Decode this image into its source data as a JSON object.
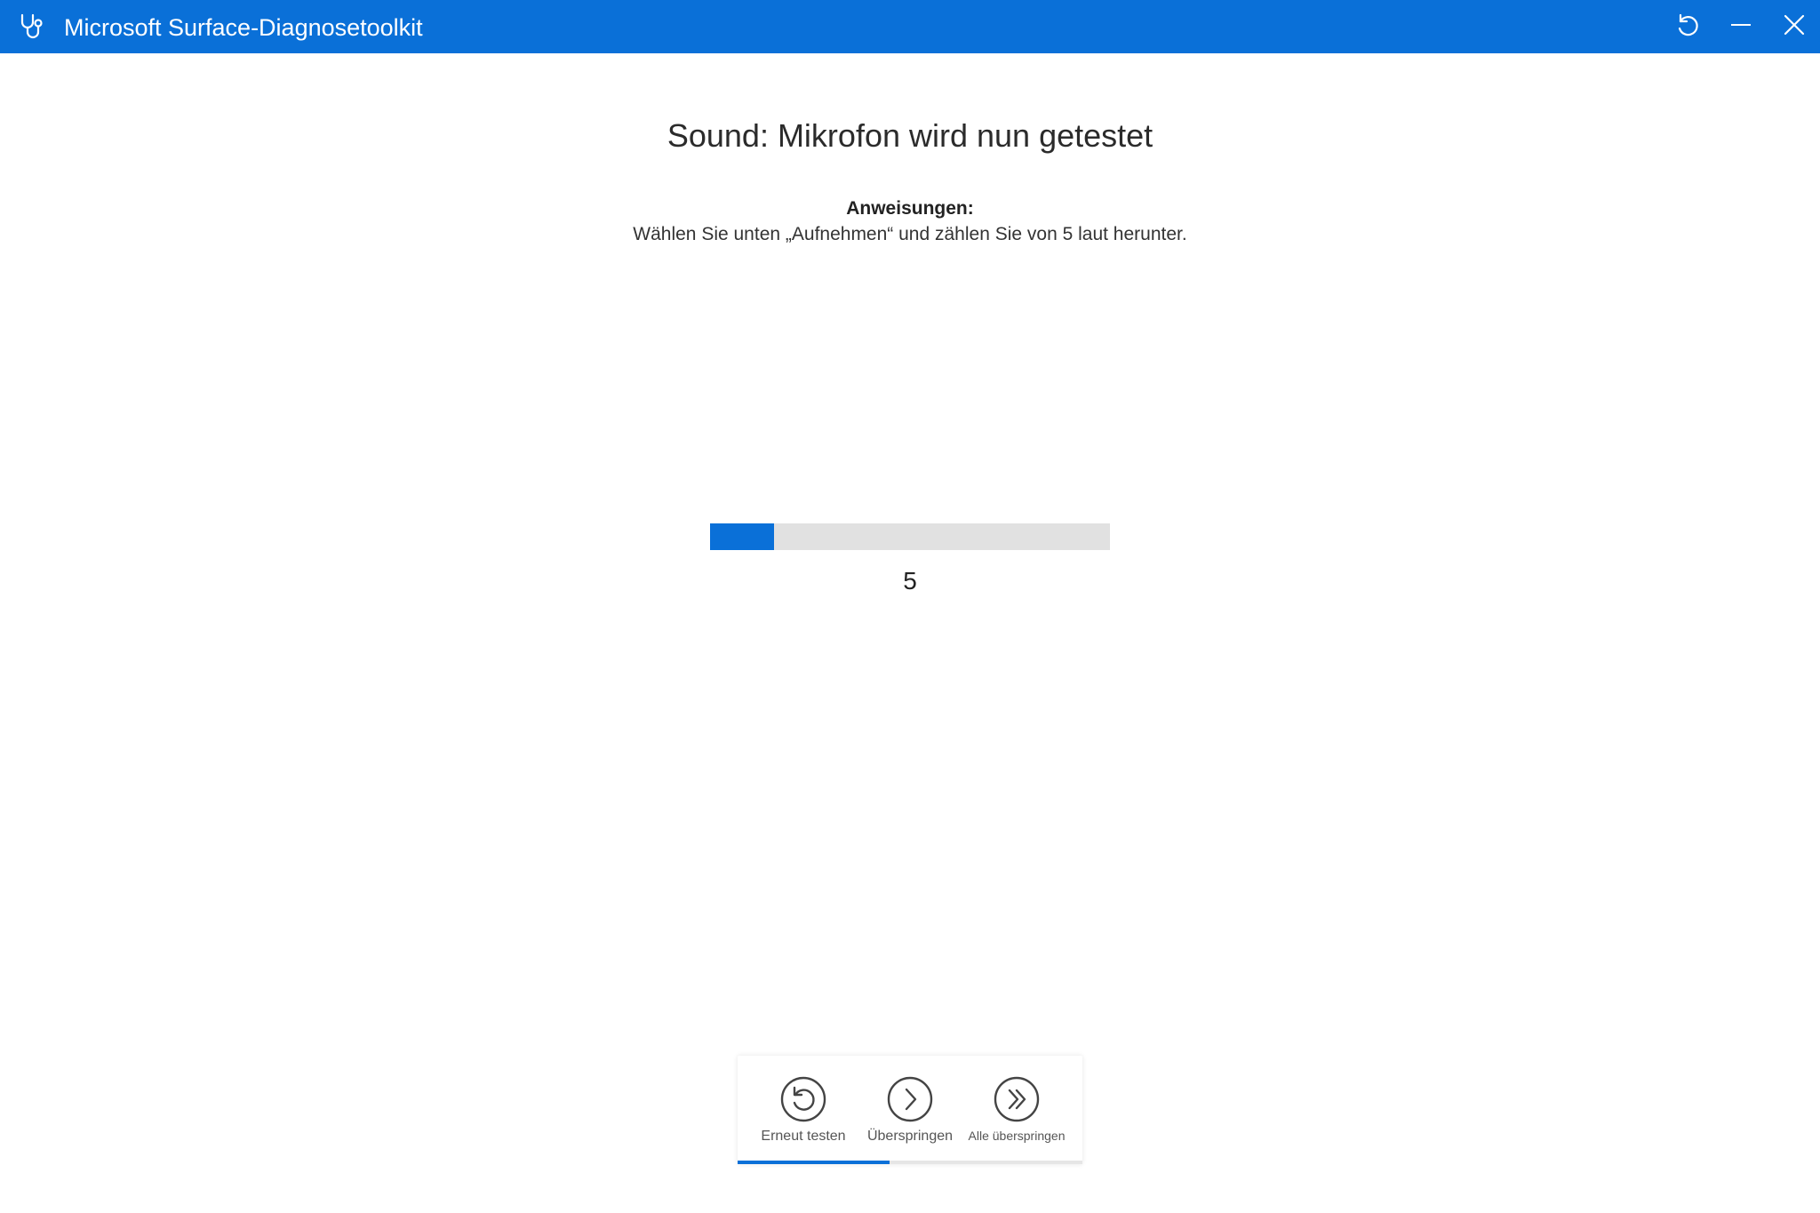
{
  "titlebar": {
    "title": "Microsoft Surface-Diagnosetoolkit",
    "app_icon": "stethoscope-icon",
    "buttons": [
      {
        "name": "refresh",
        "icon": "refresh-icon"
      },
      {
        "name": "minimize",
        "icon": "minimize-icon"
      },
      {
        "name": "close",
        "icon": "close-icon"
      }
    ],
    "background_color": "#0a70d8"
  },
  "main": {
    "heading": "Sound: Mikrofon wird nun getestet",
    "instructions_label": "Anweisungen:",
    "instructions_text": "Wählen Sie unten „Aufnehmen“ und zählen Sie von 5 laut herunter.",
    "progress_fraction": 0.16,
    "countdown": "5"
  },
  "actions": [
    {
      "label": "Erneut testen",
      "icon": "retry-icon"
    },
    {
      "label": "Überspringen",
      "icon": "skip-icon"
    },
    {
      "label": "Alle überspringen",
      "icon": "skip-all-icon"
    }
  ],
  "action_progress_fraction": 0.44,
  "colors": {
    "accent": "#0a70d8",
    "progress_track": "#e1e1e1"
  }
}
